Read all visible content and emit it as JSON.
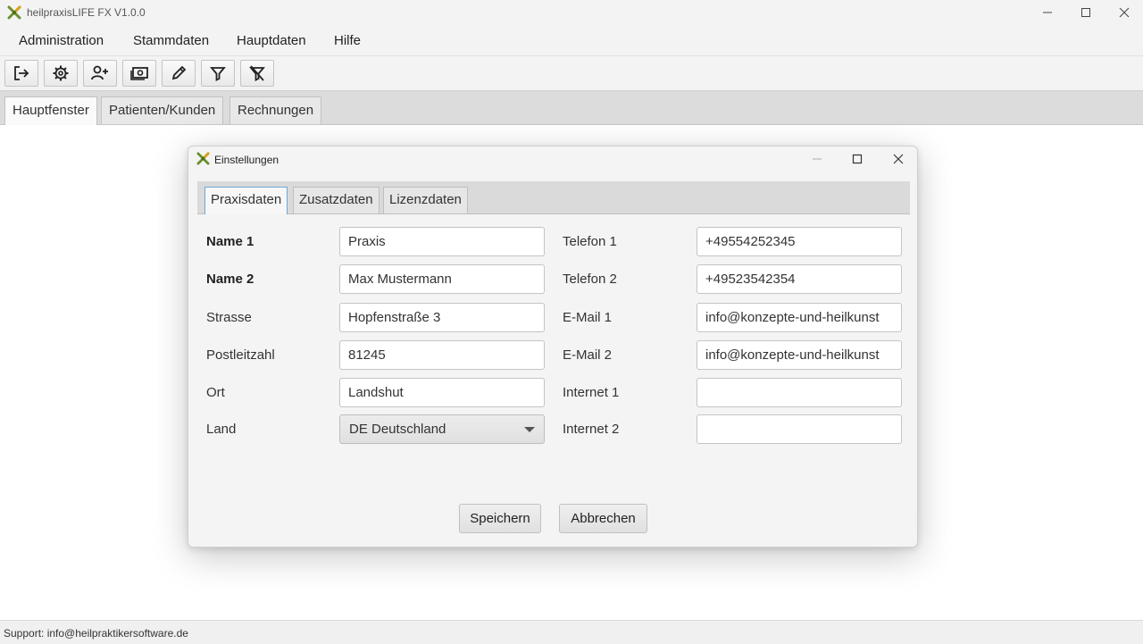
{
  "window": {
    "title": "heilpraxisLIFE FX V1.0.0"
  },
  "menu": {
    "items": [
      "Administration",
      "Stammdaten",
      "Hauptdaten",
      "Hilfe"
    ]
  },
  "toolbar": {
    "icons": [
      "logout-icon",
      "settings-gear-icon",
      "add-user-icon",
      "money-icon",
      "edit-pencil-icon",
      "filter-icon",
      "clear-filter-icon"
    ]
  },
  "main_tabs": {
    "items": [
      "Hauptfenster",
      "Patienten/Kunden",
      "Rechnungen"
    ],
    "active": "Hauptfenster"
  },
  "dialog": {
    "title": "Einstellungen",
    "tabs": [
      "Praxisdaten",
      "Zusatzdaten",
      "Lizenzdaten"
    ],
    "active_tab": "Praxisdaten",
    "left": [
      {
        "label": "Name 1",
        "value": "Praxis",
        "bold": true
      },
      {
        "label": "Name 2",
        "value": "Max Mustermann",
        "bold": true
      },
      {
        "label": "Strasse",
        "value": "Hopfenstraße 3"
      },
      {
        "label": "Postleitzahl",
        "value": "81245"
      },
      {
        "label": "Ort",
        "value": "Landshut"
      },
      {
        "label": "Land",
        "value": "DE Deutschland",
        "type": "select"
      }
    ],
    "right": [
      {
        "label": "Telefon 1",
        "value": "+49554252345"
      },
      {
        "label": "Telefon 2",
        "value": "+49523542354"
      },
      {
        "label": "E-Mail 1",
        "value": "info@konzepte-und-heilkunst"
      },
      {
        "label": "E-Mail 2",
        "value": "info@konzepte-und-heilkunst"
      },
      {
        "label": "Internet 1",
        "value": ""
      },
      {
        "label": "Internet 2",
        "value": ""
      }
    ],
    "buttons": {
      "save": "Speichern",
      "cancel": "Abbrechen"
    }
  },
  "status": {
    "text": "Support: info@heilpraktikersoftware.de"
  }
}
